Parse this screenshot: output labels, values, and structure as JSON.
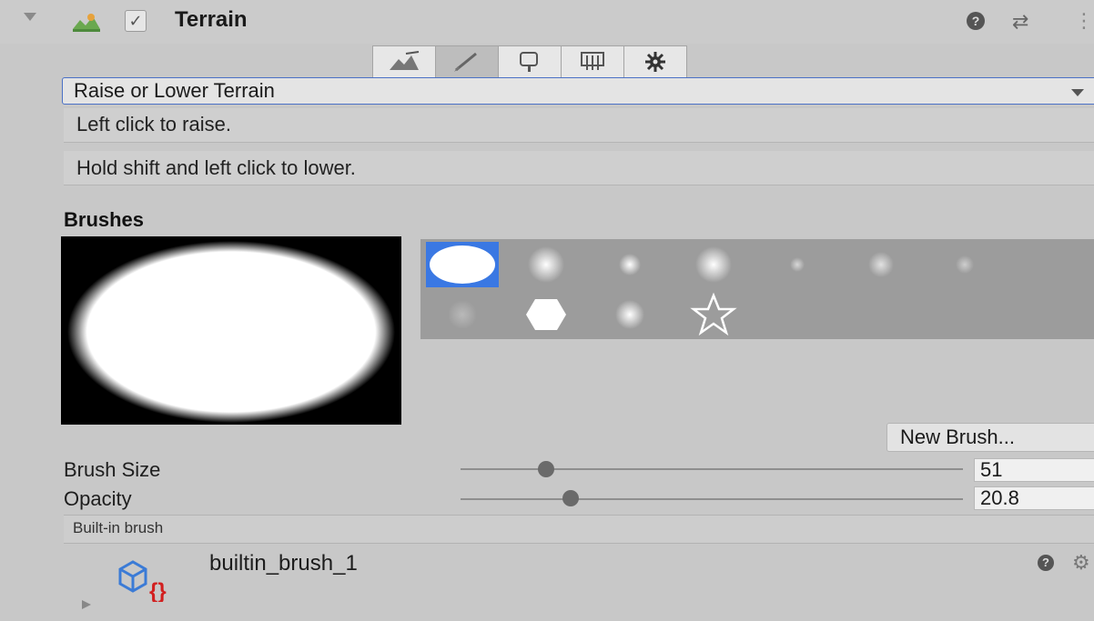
{
  "header": {
    "title": "Terrain",
    "enabled": true,
    "icons": [
      "foldout-arrow",
      "terrain-icon",
      "checkbox",
      "help-icon",
      "presets-icon",
      "menu-icon"
    ]
  },
  "tool_tabs": {
    "items": [
      {
        "name": "raise-lower-tab",
        "icon": "mountain-paint-icon"
      },
      {
        "name": "paint-tab",
        "icon": "brush-icon",
        "active": true
      },
      {
        "name": "trees-tab",
        "icon": "tree-icon"
      },
      {
        "name": "details-tab",
        "icon": "details-icon"
      },
      {
        "name": "settings-tab",
        "icon": "gear-icon"
      }
    ]
  },
  "tool_dropdown": {
    "value": "Raise or Lower Terrain"
  },
  "hints": {
    "line1": "Left click to raise.",
    "line2": "Hold shift and left click to lower."
  },
  "brushes": {
    "label": "Brushes",
    "selected_index": 0,
    "new_brush_label": "New Brush..."
  },
  "brush_size": {
    "label": "Brush Size",
    "value": "51",
    "slider_fraction": 0.17
  },
  "opacity": {
    "label": "Opacity",
    "value": "20.8",
    "slider_fraction": 0.22
  },
  "builtin": {
    "label": "Built-in brush",
    "asset_name": "builtin_brush_1"
  },
  "colors": {
    "selection": "#3a78e3",
    "focus_border": "#4b71c6"
  }
}
